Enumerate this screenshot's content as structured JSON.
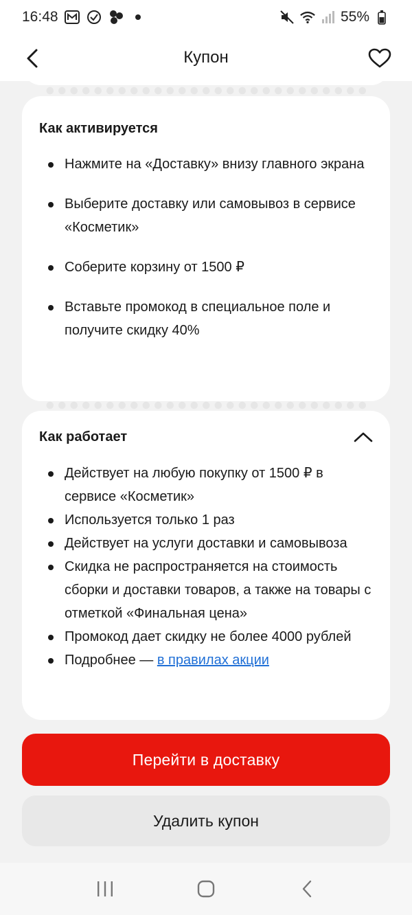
{
  "status_bar": {
    "time": "16:48",
    "battery": "55%",
    "icons": [
      "m-app-icon",
      "check-circle-icon",
      "dots-cluster-icon",
      "dot-icon",
      "mute-icon",
      "wifi-icon",
      "signal-icon",
      "battery-icon"
    ]
  },
  "header": {
    "title": "Купон",
    "back_icon": "chevron-left-icon",
    "favorite_icon": "heart-icon"
  },
  "activation": {
    "title": "Как активируется",
    "steps": [
      "Нажмите на «Доставку» внизу главного экрана",
      "Выберите доставку или самовывоз в сервисе «Косметик»",
      "Соберите корзину от 1500 ₽",
      "Вставьте промокод в специальное поле и получите скидку 40%"
    ]
  },
  "rules": {
    "title": "Как работает",
    "collapse_icon": "chevron-up-icon",
    "items": [
      "Действует на любую покупку от 1500 ₽ в сервисе «Косметик»",
      "Используется только 1 раз",
      "Действует на услуги доставки и самовывоза",
      "Скидка не распространяется на стоимость сборки и доставки товаров, а также на товары с отметкой «Финальная цена»",
      "Промокод дает скидку не более 4000 рублей"
    ],
    "more_prefix": "Подробнее — ",
    "more_link": "в правилах акции"
  },
  "actions": {
    "primary_label": "Перейти в доставку",
    "secondary_label": "Удалить купон"
  },
  "colors": {
    "accent": "#e8170e",
    "link": "#1f6fd6",
    "background": "#f2f2f2",
    "card": "#ffffff"
  },
  "navbar": {
    "icons": [
      "recent-apps-icon",
      "home-icon",
      "back-icon"
    ]
  }
}
